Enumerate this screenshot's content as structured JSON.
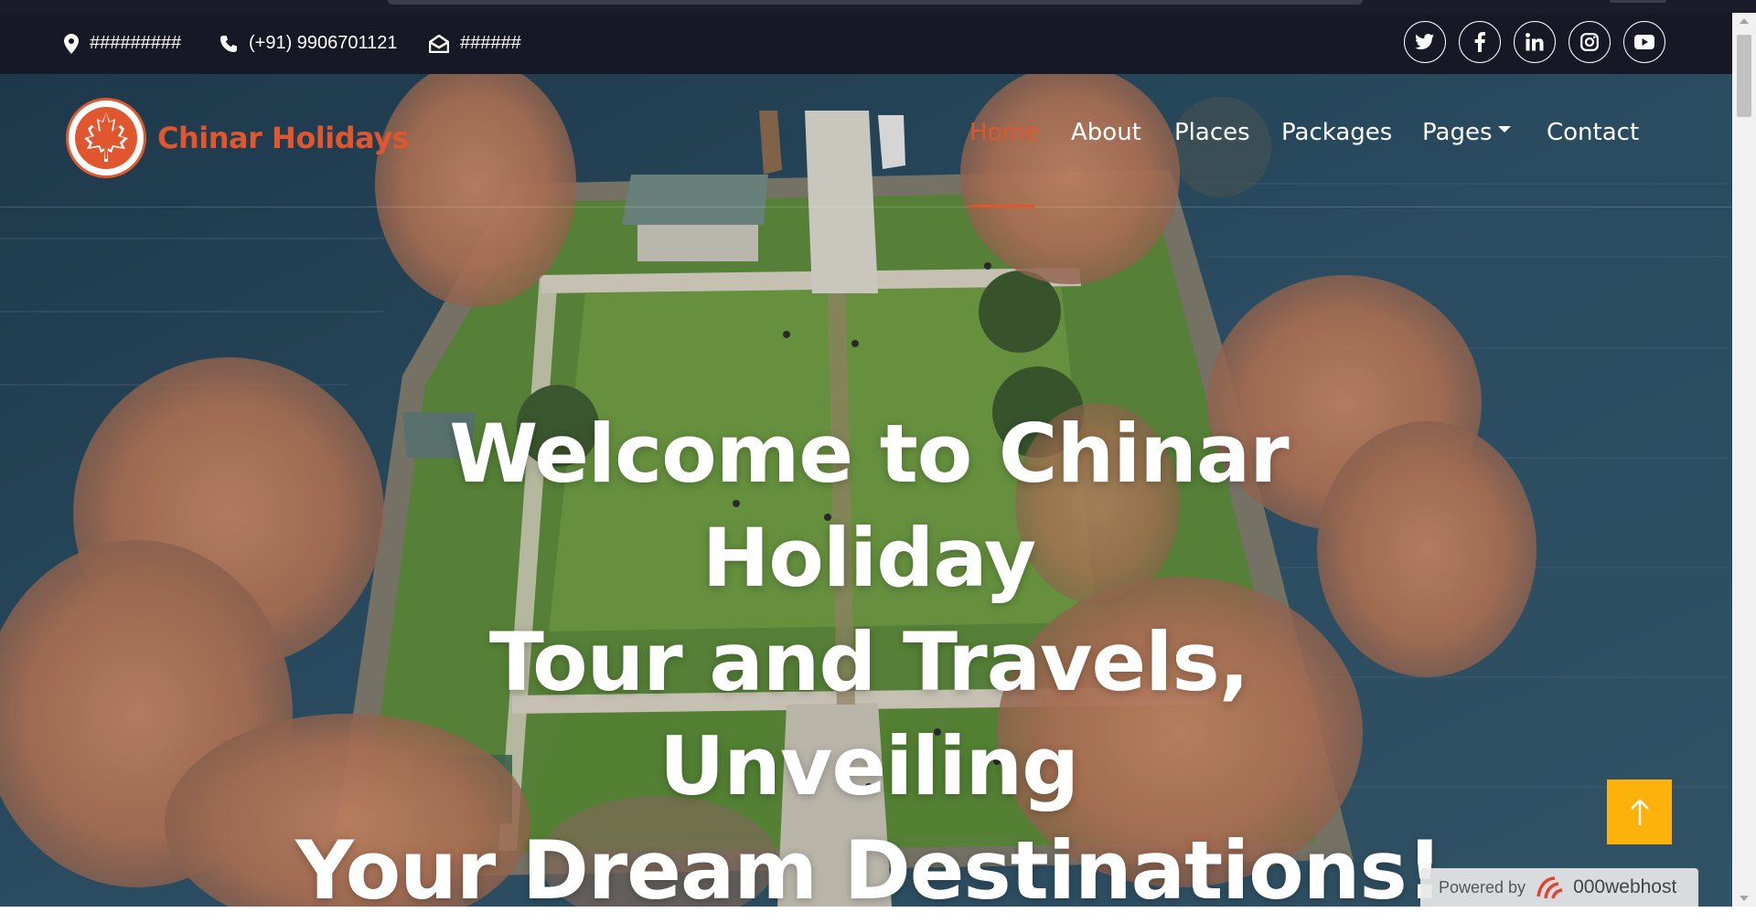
{
  "topbar": {
    "address": "#########",
    "phone": "(+91) 9906701121",
    "email": "######",
    "social_icons": [
      "twitter-icon",
      "facebook-icon",
      "linkedin-icon",
      "instagram-icon",
      "youtube-icon"
    ]
  },
  "brand": {
    "name": "Chinar Holidays",
    "color": "#e0572f"
  },
  "nav": {
    "items": [
      {
        "label": "Home",
        "active": true
      },
      {
        "label": "About"
      },
      {
        "label": "Places"
      },
      {
        "label": "Packages"
      },
      {
        "label": "Pages",
        "dropdown": true
      },
      {
        "label": "Contact"
      }
    ]
  },
  "hero": {
    "headline_line1": "Welcome to Chinar Holiday",
    "headline_line2": "Tour and Travels, Unveiling",
    "headline_line3": "Your Dream Destinations!"
  },
  "back_to_top": {
    "icon": "arrow-up-icon",
    "color": "#fdb10b"
  },
  "powered_badge": {
    "prefix": "Powered by",
    "brand": "000webhost"
  }
}
